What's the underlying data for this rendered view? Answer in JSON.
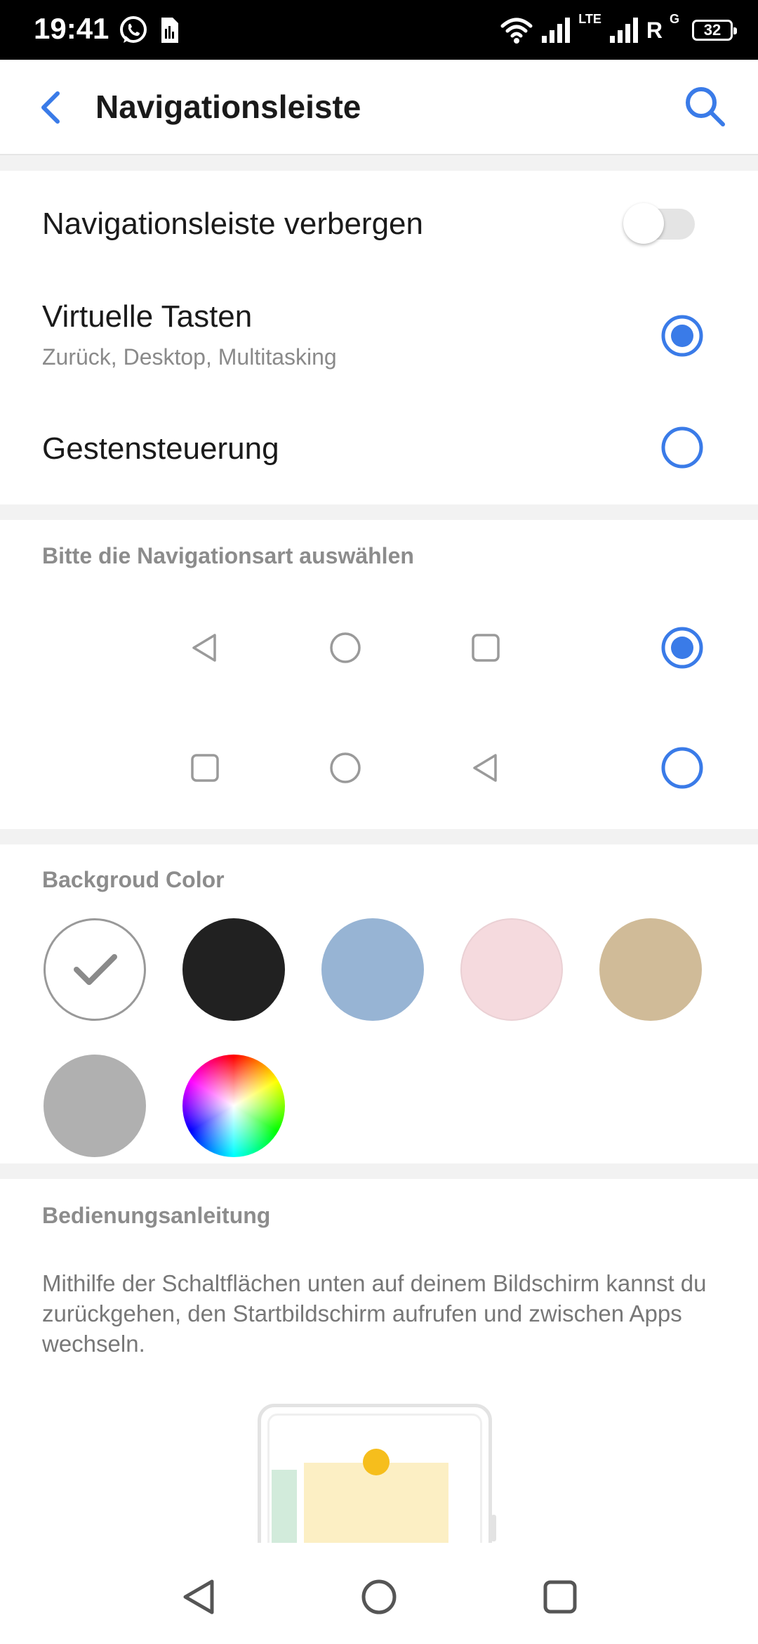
{
  "status_bar": {
    "time": "19:41",
    "network_lte": "LTE",
    "roaming": "R",
    "network_g": "G",
    "battery": "32"
  },
  "header": {
    "title": "Navigationsleiste",
    "back_icon": "chevron-left-icon",
    "search_icon": "search-icon"
  },
  "settings": {
    "hide_bar_label": "Navigationsleiste verbergen",
    "hide_bar_on": false,
    "virtual_keys_label": "Virtuelle Tasten",
    "virtual_keys_sub": "Zurück, Desktop, Multitasking",
    "virtual_keys_selected": true,
    "gestures_label": "Gestensteuerung",
    "gestures_selected": false
  },
  "navigation_type": {
    "title": "Bitte die Navigationsart auswählen",
    "options": [
      {
        "layout": [
          "back",
          "home",
          "recents"
        ],
        "selected": true
      },
      {
        "layout": [
          "recents",
          "home",
          "back"
        ],
        "selected": false
      }
    ]
  },
  "background_color": {
    "title": "Backgroud Color",
    "swatches": [
      {
        "color": "#ffffff",
        "selected": true
      },
      {
        "color": "#212121",
        "selected": false
      },
      {
        "color": "#97b4d4",
        "selected": false
      },
      {
        "color": "#f5dade",
        "selected": false
      },
      {
        "color": "#d0bb98",
        "selected": false
      },
      {
        "color": "#b0b0b0",
        "selected": false
      },
      {
        "color": "color-wheel",
        "selected": false
      }
    ]
  },
  "guide": {
    "title": "Bedienungsanleitung",
    "text": "Mithilfe der Schaltflächen unten auf deinem Bildschirm kannst du zurückgehen, den Startbildschirm aufrufen und zwischen Apps wechseln."
  },
  "colors": {
    "accent": "#3a7be8",
    "section_gap": "#f2f2f2"
  }
}
